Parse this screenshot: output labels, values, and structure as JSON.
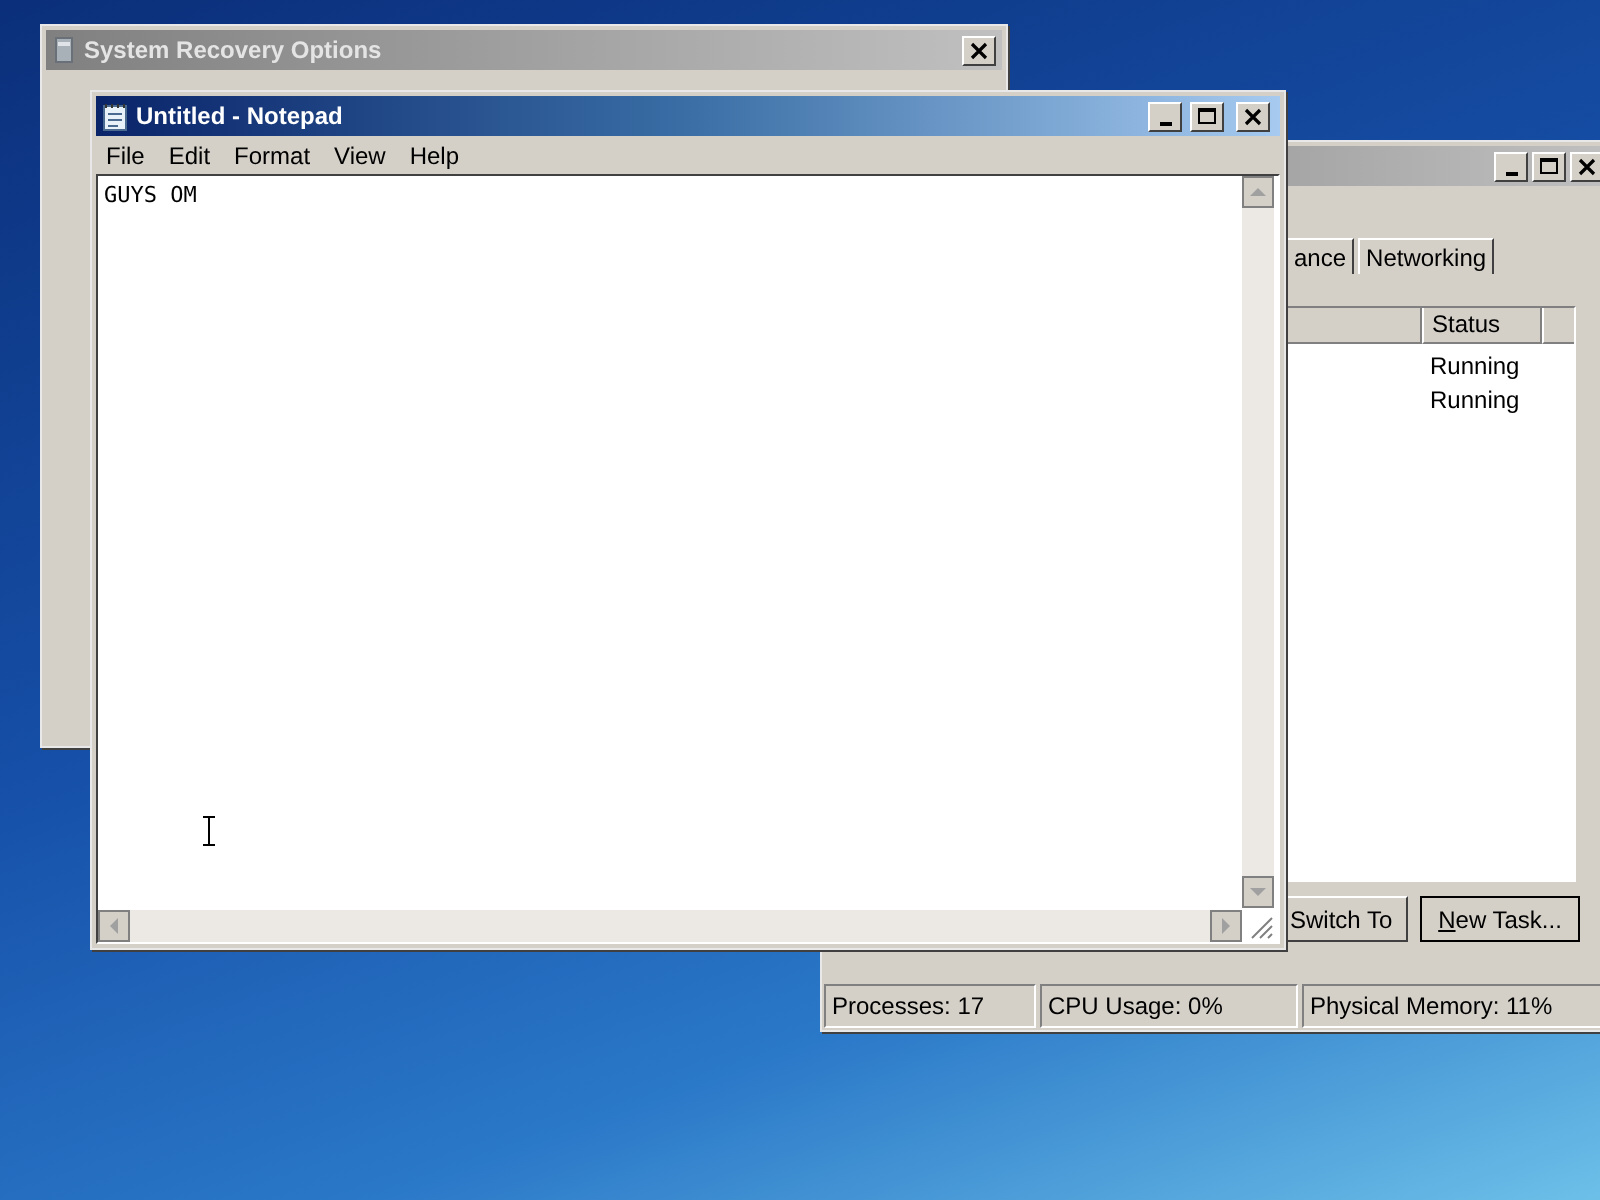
{
  "recovery_window": {
    "title": "System Recovery Options"
  },
  "task_manager": {
    "tabs": [
      {
        "label": "ance",
        "selected": false
      },
      {
        "label": "Networking",
        "selected": false
      }
    ],
    "columns": [
      "Status"
    ],
    "rows": [
      {
        "status": "Running"
      },
      {
        "status": "Running"
      }
    ],
    "buttons": [
      "Switch To",
      "New Task..."
    ],
    "status_bar": [
      "Processes: 17",
      "CPU Usage: 0%",
      "Physical Memory: 11%"
    ]
  },
  "notepad": {
    "title": "Untitled - Notepad",
    "menu": [
      "File",
      "Edit",
      "Format",
      "View",
      "Help"
    ],
    "text": "GUYS OM"
  }
}
